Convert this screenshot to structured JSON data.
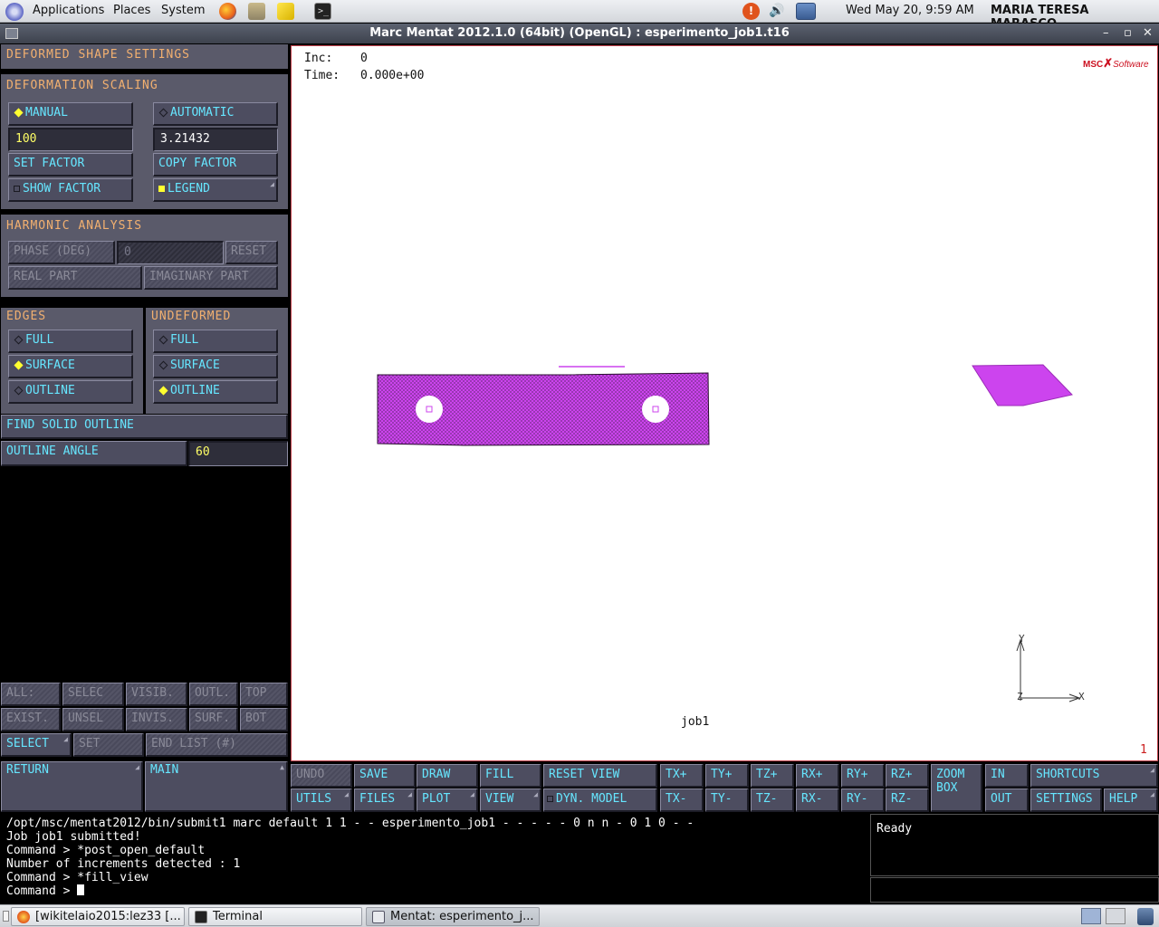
{
  "topbar": {
    "menus": [
      "Applications",
      "Places",
      "System"
    ],
    "clock": "Wed May 20,  9:59 AM",
    "user": "MARIA TERESA MARASCO"
  },
  "window": {
    "title": "Marc Mentat 2012.1.0 (64bit) (OpenGL) : esperimento_job1.t16"
  },
  "panel": {
    "title": "DEFORMED SHAPE SETTINGS",
    "deformation_scaling": {
      "header": "DEFORMATION SCALING",
      "manual": "MANUAL",
      "automatic": "AUTOMATIC",
      "manual_value": "100",
      "auto_value": "3.21432",
      "set_factor": "SET FACTOR",
      "copy_factor": "COPY FACTOR",
      "show_factor": "SHOW FACTOR",
      "legend": "LEGEND"
    },
    "harmonic": {
      "header": "HARMONIC ANALYSIS",
      "phase": "PHASE (DEG)",
      "phase_value": "0",
      "reset": "RESET",
      "real_part": "REAL PART",
      "imaginary_part": "IMAGINARY PART"
    },
    "edges": {
      "header": "EDGES",
      "full": "FULL",
      "surface": "SURFACE",
      "outline": "OUTLINE"
    },
    "undeformed": {
      "header": "UNDEFORMED",
      "full": "FULL",
      "surface": "SURFACE",
      "outline": "OUTLINE"
    },
    "find_solid_outline": "FIND SOLID OUTLINE",
    "outline_angle": {
      "label": "OUTLINE ANGLE",
      "value": "60"
    },
    "select_grid": [
      "ALL:",
      "SELEC",
      "VISIB.",
      "OUTL.",
      "TOP",
      "EXIST.",
      "UNSEL",
      "INVIS.",
      "SURF.",
      "BOT"
    ],
    "select": "SELECT",
    "set": "SET",
    "end_list": "END LIST (#)",
    "return": "RETURN",
    "main": "MAIN"
  },
  "viewport": {
    "inc_label": "Inc:",
    "inc_value": "0",
    "time_label": "Time:",
    "time_value": "0.000e+00",
    "logo_a": "MSC",
    "logo_b": "Software",
    "job_label": "job1",
    "axis_y": "Y",
    "axis_x": "X",
    "axis_z": "Z",
    "viewport_number": "1",
    "model_color": "#cc44ee"
  },
  "toolbar": {
    "undo": "UNDO",
    "save": "SAVE",
    "draw": "DRAW",
    "fill": "FILL",
    "reset_view": "RESET VIEW",
    "tx_plus": "TX+",
    "ty_plus": "TY+",
    "tz_plus": "TZ+",
    "rx_plus": "RX+",
    "ry_plus": "RY+",
    "rz_plus": "RZ+",
    "zoom_box": "ZOOM BOX",
    "in": "IN",
    "shortcuts": "SHORTCUTS",
    "utils": "UTILS",
    "files": "FILES",
    "plot": "PLOT",
    "view": "VIEW",
    "dyn_model": "DYN. MODEL",
    "tx_minus": "TX-",
    "ty_minus": "TY-",
    "tz_minus": "TZ-",
    "rx_minus": "RX-",
    "ry_minus": "RY-",
    "rz_minus": "RZ-",
    "out": "OUT",
    "settings": "SETTINGS",
    "help": "HELP"
  },
  "console": {
    "lines": [
      "/opt/msc/mentat2012/bin/submit1 marc default 1 1 - - esperimento_job1 - - - - - 0 n n - 0 1 0 - -",
      "Job job1 submitted!",
      "Command > *post_open_default",
      "Number of increments detected : 1",
      "Command > *fill_view",
      "Command > "
    ]
  },
  "status": {
    "text": "Ready"
  },
  "taskbar": {
    "tasks": [
      "[wikitelaio2015:lez33 [...",
      "Terminal",
      "Mentat: esperimento_j..."
    ]
  }
}
